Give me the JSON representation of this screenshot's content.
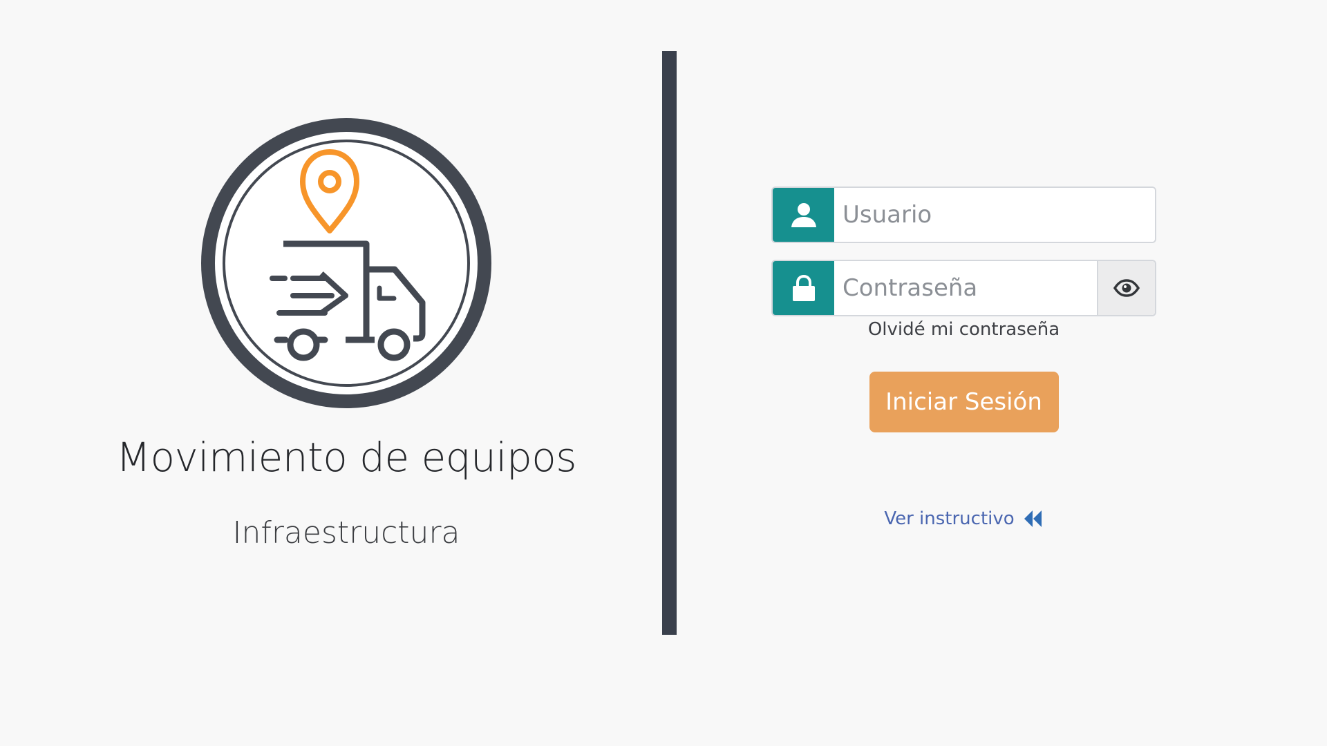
{
  "app": {
    "title": "Movimiento de equipos",
    "subtitle": "Infraestructura",
    "logo_icon": "delivery-truck-location-icon"
  },
  "login": {
    "username_placeholder": "Usuario",
    "username_value": "",
    "password_placeholder": "Contraseña",
    "password_value": "",
    "forgot_password": "Olvidé mi contraseña",
    "submit_label": "Iniciar Sesión",
    "instructions_link": "Ver instructivo"
  },
  "icons": {
    "user": "user-icon",
    "lock": "lock-icon",
    "eye": "eye-icon",
    "rewind": "double-chevron-left-icon"
  },
  "colors": {
    "background": "#f8f8f8",
    "divider": "#3a404c",
    "addon": "#16908f",
    "primary_button": "#e9a15b",
    "logo_accent": "#f7952a",
    "logo_dark": "#434851",
    "link": "#4a66b0"
  }
}
